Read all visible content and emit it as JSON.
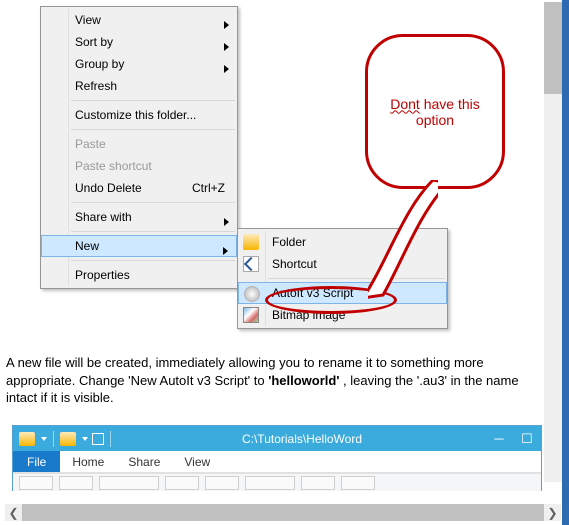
{
  "context_menu": {
    "items": [
      {
        "label": "View",
        "arrow": true
      },
      {
        "label": "Sort by",
        "arrow": true
      },
      {
        "label": "Group by",
        "arrow": true
      },
      {
        "label": "Refresh"
      }
    ],
    "customize": "Customize this folder...",
    "paste": "Paste",
    "paste_shortcut": "Paste shortcut",
    "undo": {
      "label": "Undo Delete",
      "shortcut": "Ctrl+Z"
    },
    "share": "Share with",
    "new_label": "New",
    "properties": "Properties"
  },
  "submenu": {
    "folder": "Folder",
    "shortcut": "Shortcut",
    "autoit": "AutoIt v3 Script",
    "bitmap": "Bitmap image"
  },
  "callout": {
    "line1": "Dont",
    "line2": "have this",
    "line3": "option"
  },
  "paragraph": {
    "t1": "A new file will be created, immediately allowing you to rename it to something more appropriate. Change 'New AutoIt v3 Script' to ",
    "bold": "'helloworld'",
    "t2": ", leaving the '.au3' in the name intact if it is visible."
  },
  "explorer": {
    "title": "C:\\Tutorials\\HelloWord",
    "tabs": {
      "file": "File",
      "home": "Home",
      "share": "Share",
      "view": "View"
    }
  }
}
